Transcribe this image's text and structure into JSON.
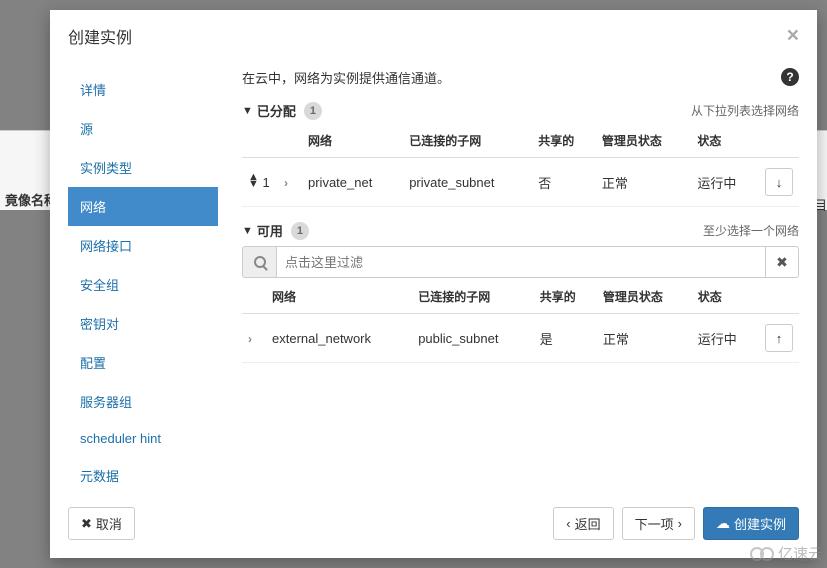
{
  "background": {
    "left_label": "竟像名称",
    "right_label": "目"
  },
  "modal": {
    "title": "创建实例",
    "close": "×",
    "sidebar": {
      "items": [
        {
          "id": "details",
          "label": "详情"
        },
        {
          "id": "source",
          "label": "源"
        },
        {
          "id": "flavor",
          "label": "实例类型"
        },
        {
          "id": "network",
          "label": "网络"
        },
        {
          "id": "network-port",
          "label": "网络接口"
        },
        {
          "id": "security-group",
          "label": "安全组"
        },
        {
          "id": "keypair",
          "label": "密钥对"
        },
        {
          "id": "config",
          "label": "配置"
        },
        {
          "id": "server-group",
          "label": "服务器组"
        },
        {
          "id": "scheduler",
          "label": "scheduler hint"
        },
        {
          "id": "metadata",
          "label": "元数据"
        }
      ],
      "active_index": 3
    },
    "panel": {
      "description": "在云中，网络为实例提供通信通道。",
      "help_icon": "?",
      "allocated": {
        "title": "已分配",
        "count": "1",
        "hint": "从下拉列表选择网络"
      },
      "available": {
        "title": "可用",
        "count": "1",
        "hint": "至少选择一个网络"
      },
      "columns": {
        "network": "网络",
        "subnet": "已连接的子网",
        "shared": "共享的",
        "admin_state": "管理员状态",
        "status": "状态"
      },
      "allocated_rows": [
        {
          "order": "1",
          "name": "private_net",
          "subnet": "private_subnet",
          "shared": "否",
          "admin": "正常",
          "status": "运行中",
          "expandable": true
        }
      ],
      "available_rows": [
        {
          "name": "external_network",
          "subnet": "public_subnet",
          "shared": "是",
          "admin": "正常",
          "status": "运行中",
          "expandable": true
        }
      ],
      "filter_placeholder": "点击这里过滤",
      "down_arrow": "↓",
      "up_arrow": "↑"
    },
    "footer": {
      "cancel": "取消",
      "back": "返回",
      "next": "下一项",
      "submit": "创建实例"
    }
  },
  "watermark": {
    "text": "亿速云"
  }
}
